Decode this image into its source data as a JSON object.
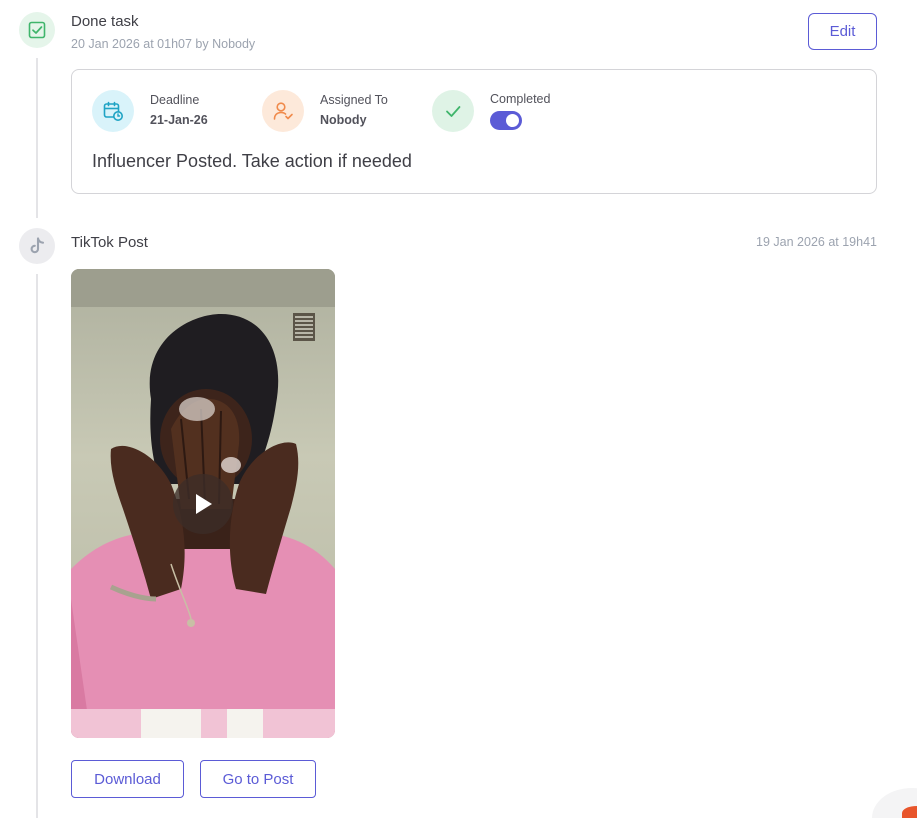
{
  "events": [
    {
      "kind": "task",
      "icon": "checkbox-icon",
      "title": "Done task",
      "subtitle": "20 Jan 2026 at 01h07 by Nobody",
      "edit_label": "Edit",
      "card": {
        "deadline": {
          "label": "Deadline",
          "value": "21-Jan-26",
          "icon": "calendar-clock-icon"
        },
        "assigned": {
          "label": "Assigned To",
          "value": "Nobody",
          "icon": "user-check-icon"
        },
        "completed": {
          "label": "Completed",
          "icon": "check-icon",
          "toggle_on": true
        },
        "description": "Influencer Posted. Take action if needed"
      }
    },
    {
      "kind": "post",
      "icon": "tiktok-icon",
      "title": "TikTok Post",
      "date": "19 Jan 2026 at 19h41",
      "video": {
        "icon": "play-icon"
      },
      "download_label": "Download",
      "goto_label": "Go to Post"
    }
  ],
  "colors": {
    "accent": "#5b5bd6",
    "success_bg": "#e5f5ea",
    "success": "#3fb56b",
    "info_bg": "#d9f3fa",
    "info": "#1fa3c4",
    "warn_bg": "#fde9da",
    "warn": "#f08a4b"
  }
}
